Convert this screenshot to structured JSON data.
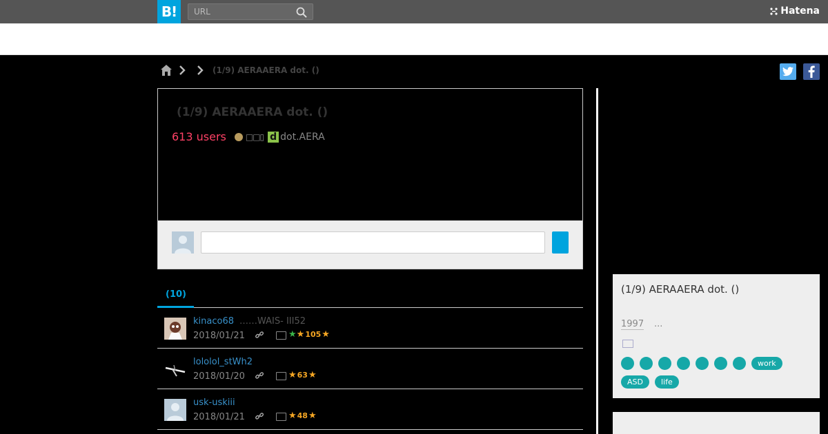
{
  "topbar": {
    "logo": "B!",
    "search_placeholder": "URL",
    "brand": "Hatena"
  },
  "breadcrumb": {
    "title": "(1/9) AERAAERA dot. ()"
  },
  "entry": {
    "title": "(1/9) AERAAERA dot. ()",
    "users": "613 users",
    "kanji": "□□▯",
    "d_icon": "d",
    "site": "dot.AERA"
  },
  "tabs": {
    "active": "(10)"
  },
  "bookmarks": [
    {
      "user": "kinaco68",
      "comment": "……WAIS- III52",
      "date": "2018/01/21",
      "green_star": true,
      "count": "105"
    },
    {
      "user": "lololol_stWh2",
      "comment": "",
      "date": "2018/01/20",
      "green_star": false,
      "count": "63"
    },
    {
      "user": "usk-uskiii",
      "comment": "",
      "date": "2018/01/21",
      "green_star": false,
      "count": "48"
    }
  ],
  "sidebar": {
    "title": "(1/9) AERAAERA dot. ()",
    "year": "1997",
    "more": "...",
    "tags": [
      "",
      "",
      "",
      "",
      "",
      "",
      "",
      "work",
      "ASD",
      "life"
    ]
  },
  "colors": {
    "accent": "#00a4de",
    "users": "#ff4166",
    "tag": "#16a8a8",
    "star": "#f5a623"
  }
}
